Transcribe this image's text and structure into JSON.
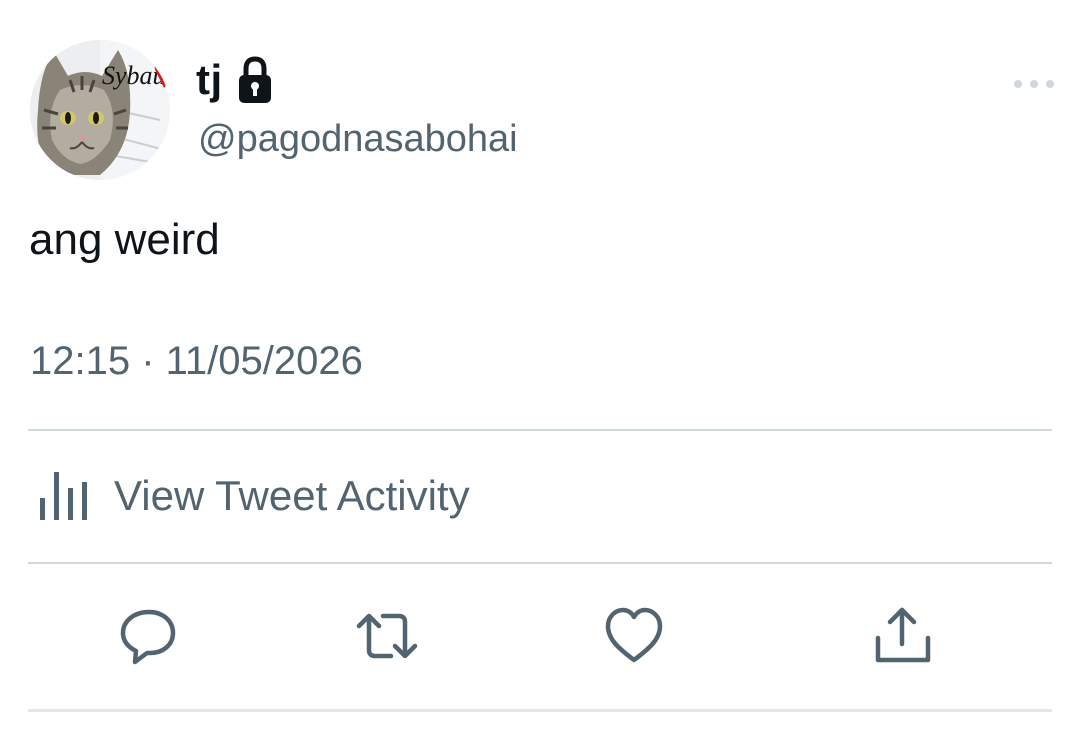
{
  "author": {
    "display_name": "tj",
    "handle": "@pagodnasabohai",
    "protected_icon": "lock-icon",
    "avatar_text": "Sybau"
  },
  "tweet": {
    "text": "ang weird",
    "timestamp": "12:15 · 11/05/2026"
  },
  "activity": {
    "label": "View Tweet Activity",
    "icon": "bar-chart-icon"
  },
  "actions": [
    {
      "name": "reply",
      "icon": "reply-icon"
    },
    {
      "name": "retweet",
      "icon": "retweet-icon"
    },
    {
      "name": "like",
      "icon": "heart-icon"
    },
    {
      "name": "share",
      "icon": "share-icon"
    }
  ],
  "colors": {
    "primary_text": "#0f1419",
    "secondary_text": "#536471",
    "divider": "#cfd9de"
  }
}
